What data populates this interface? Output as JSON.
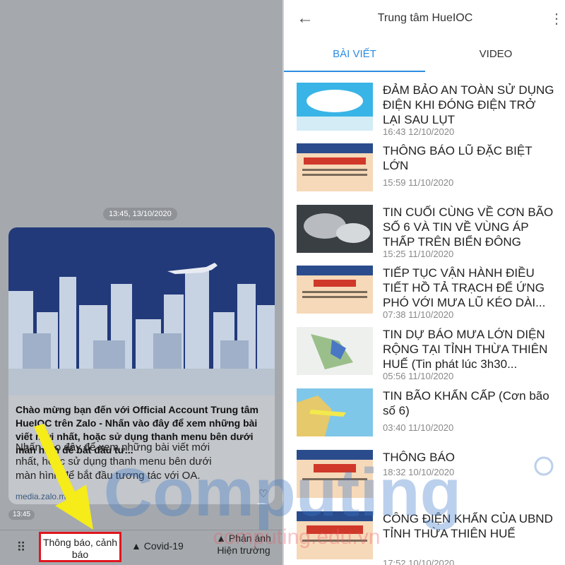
{
  "left": {
    "date_pill": "13:45, 13/10/2020",
    "card": {
      "title": "Chào mừng bạn đến với Official Account Trung tâm HueIOC trên Zalo - Nhấn vào đây để xem những bài viết mới nhất, hoặc sử dụng thanh menu bên dưới màn hình để bắt đầu tư...",
      "description": "Nhấn vào đây để xem những bài viết mới nhất, hoặc sử dụng thanh menu bên dưới màn hình để bắt đầu tương tác với OA.",
      "link": "media.zalo.me"
    },
    "msg_time": "13:45",
    "menu": {
      "keyboard_icon": "keyboard-icon",
      "item1": "Thông báo, cảnh báo",
      "item2": "▲ Covid-19",
      "item3": "▲ Phản ánh Hiện trường"
    }
  },
  "right": {
    "header": {
      "title": "Trung tâm HueIOC",
      "back_icon": "arrow-left-icon",
      "more_icon": "more-vertical-icon"
    },
    "tabs": [
      "BÀI VIẾT",
      "VIDEO"
    ],
    "articles": [
      {
        "title": "ĐẢM BẢO AN TOÀN SỬ DỤNG ĐIỆN KHI ĐÓNG ĐIỆN TRỞ LẠI SAU LỤT",
        "time": "16:43 12/10/2020"
      },
      {
        "title": "THÔNG BÁO LŨ ĐẶC BIỆT LỚN",
        "time": "15:59 11/10/2020"
      },
      {
        "title": "TIN CUỐI CÙNG VỀ CƠN BÃO SỐ 6 VÀ TIN VỀ VÙNG ÁP THẤP TRÊN BIỂN ĐÔNG",
        "time": "15:25 11/10/2020"
      },
      {
        "title": "TIẾP TỤC VẬN HÀNH ĐIỀU TIẾT HỒ TẢ TRẠCH ĐỂ ỨNG PHÓ VỚI MƯA LŨ KÉO DÀI...",
        "time": "07:38 11/10/2020"
      },
      {
        "title": "TIN DỰ BÁO MƯA LỚN DIỆN RỘNG TẠI TỈNH THỪA THIÊN HUẾ (Tin phát lúc 3h30...",
        "time": "05:56 11/10/2020"
      },
      {
        "title": "TIN BÃO KHẨN CẤP (Cơn bão số 6)",
        "time": "03:40 11/10/2020"
      },
      {
        "title": "THÔNG BÁO",
        "time": "18:32 10/10/2020"
      },
      {
        "title": "CÔNG ĐIỆN KHẨN CỦA UBND TỈNH THỪA THIÊN HUẾ",
        "time": "17:52 10/10/2020"
      }
    ]
  },
  "watermark": {
    "brand": "Computing",
    "site": "computing.edu.vn"
  }
}
